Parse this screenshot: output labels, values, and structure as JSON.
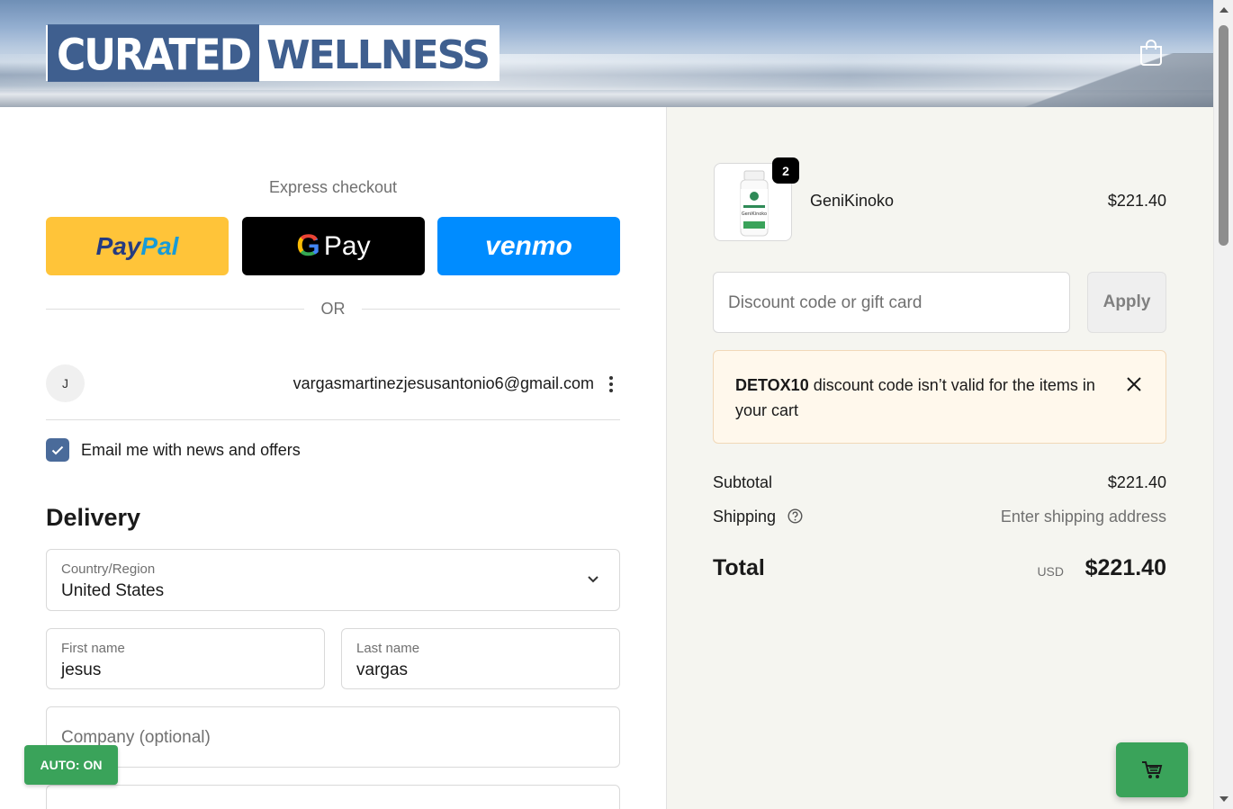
{
  "header": {
    "logo_part1": "CURATED",
    "logo_part2": "WELLNESS",
    "cart_icon": "shopping-bag-icon"
  },
  "express": {
    "title": "Express checkout",
    "paypal_a": "Pay",
    "paypal_b": "Pal",
    "gpay_g": "G",
    "gpay_label": "Pay",
    "venmo_label": "venmo",
    "or_label": "OR"
  },
  "account": {
    "avatar_initial": "J",
    "email": "vargasmartinezjesusantonio6@gmail.com",
    "news_label": "Email me with news and offers",
    "news_checked": true
  },
  "delivery": {
    "heading": "Delivery",
    "country_label": "Country/Region",
    "country_value": "United States",
    "first_name_label": "First name",
    "first_name_value": "jesus",
    "last_name_label": "Last name",
    "last_name_value": "vargas",
    "company_placeholder": "Company (optional)"
  },
  "summary": {
    "product": {
      "name": "GeniKinoko",
      "price": "$221.40",
      "quantity": "2",
      "bottle_label": "GeniKinoko"
    },
    "discount_placeholder": "Discount code or gift card",
    "apply_label": "Apply",
    "notice_code": "DETOX10",
    "notice_text": " discount code isn’t valid for the items in your cart",
    "subtotal_label": "Subtotal",
    "subtotal_value": "$221.40",
    "shipping_label": "Shipping",
    "shipping_value": "Enter shipping address",
    "total_label": "Total",
    "total_currency": "USD",
    "total_value": "$221.40"
  },
  "widgets": {
    "auto_label": "AUTO: ON",
    "float_cart_icon": "cart-icon"
  },
  "colors": {
    "paypal_bg": "#ffc439",
    "gpay_bg": "#000000",
    "venmo_bg": "#008cff",
    "accent_checkbox": "#4a6b9a",
    "widget_green": "#3aa35a",
    "notice_bg": "#fff8ec"
  }
}
